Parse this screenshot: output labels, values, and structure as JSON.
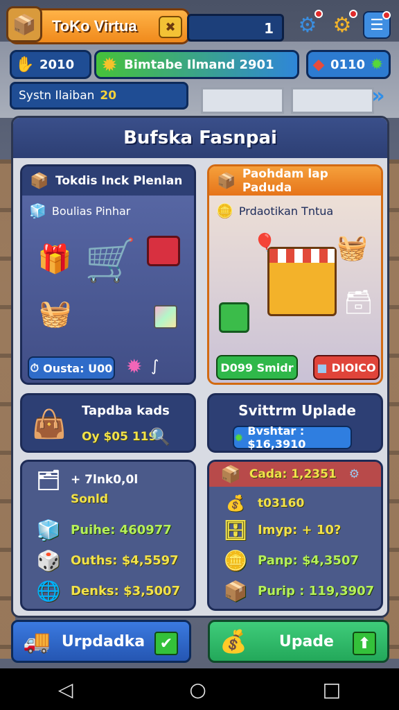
{
  "header": {
    "shop_title": "ToKo Virtua",
    "level_value": "1",
    "icons": [
      "gear-icon",
      "gear-icon",
      "notes-icon"
    ]
  },
  "stats": {
    "coins": "2010",
    "banner": "Bimtabe Ilmand 2901",
    "gems": "0110",
    "system_label": "Systn Ilaiban",
    "system_value": "20"
  },
  "panel": {
    "title": "Bufska Fasnpai",
    "left_card": {
      "title": "Tokdis Inck Plenlan",
      "subtitle": "Boulias Pinhar",
      "button": "Ousta: U00"
    },
    "right_card": {
      "title": "Paohdam lap Paduda",
      "subtitle": "Prdaotikan Tntua",
      "green_button": "D099 Smidr",
      "red_button": "DIOICO"
    },
    "mid_left": {
      "title": "Tapdba kads",
      "value": "Oy $05 119"
    },
    "mid_right": {
      "title": "Svittrm Uplade",
      "value": "Bvshtar : $16,3910"
    },
    "stats_left": [
      {
        "label": "+ 7lnk0,0l",
        "icon": "box-stack-icon"
      },
      {
        "label": "Sonld",
        "icon": ""
      },
      {
        "label": "Puihe: 460977",
        "icon": "cube-icon"
      },
      {
        "label": "Ouths: $4,5597",
        "icon": "dice-icon"
      },
      {
        "label": "Denks: $3,5007",
        "icon": "globe-icon"
      }
    ],
    "stats_right": [
      {
        "label": "Cada: 1,2351",
        "icon": "crate-icon"
      },
      {
        "label": "t03160",
        "icon": "bag-icon"
      },
      {
        "label": "Imyp: + 10?",
        "icon": "safe-icon"
      },
      {
        "label": "Panp: $4,3507",
        "icon": "coin-stack-icon"
      },
      {
        "label": "Purip : 119,3907",
        "icon": "crate-icon"
      }
    ]
  },
  "bottom": {
    "left_button": "Urpdadka",
    "right_button": "Upade"
  },
  "colors": {
    "accent_orange": "#f08a1c",
    "panel_blue": "#2d3f74",
    "card_orange": "#f07e20",
    "green": "#2fb84a",
    "red": "#e0443a"
  }
}
